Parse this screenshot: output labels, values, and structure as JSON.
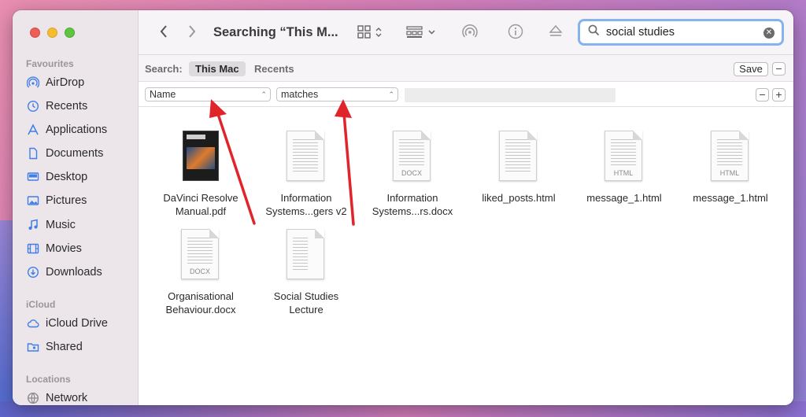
{
  "window": {
    "title": "Searching “This M...",
    "search_value": "social studies"
  },
  "sidebar": {
    "sections": [
      {
        "label": "Favourites"
      },
      {
        "label": "iCloud"
      },
      {
        "label": "Locations"
      }
    ],
    "favourites": [
      {
        "label": "AirDrop",
        "icon": "airdrop-icon"
      },
      {
        "label": "Recents",
        "icon": "clock-icon"
      },
      {
        "label": "Applications",
        "icon": "applications-icon"
      },
      {
        "label": "Documents",
        "icon": "document-icon"
      },
      {
        "label": "Desktop",
        "icon": "desktop-icon"
      },
      {
        "label": "Pictures",
        "icon": "photo-icon"
      },
      {
        "label": "Music",
        "icon": "music-icon"
      },
      {
        "label": "Movies",
        "icon": "film-icon"
      },
      {
        "label": "Downloads",
        "icon": "download-icon"
      }
    ],
    "icloud": [
      {
        "label": "iCloud Drive",
        "icon": "cloud-icon"
      },
      {
        "label": "Shared",
        "icon": "shared-folder-icon"
      }
    ],
    "locations": [
      {
        "label": "Network",
        "icon": "globe-icon"
      }
    ]
  },
  "scope": {
    "label": "Search:",
    "this_mac": "This Mac",
    "recents": "Recents",
    "save": "Save"
  },
  "rule": {
    "attribute": "Name",
    "operator": "matches"
  },
  "files": [
    {
      "name": "DaVinci Resolve Manual.pdf",
      "line1": "DaVinci Resolve",
      "line2": "Manual.pdf",
      "kind": "pdf"
    },
    {
      "name": "Information Systems...gers v2",
      "line1": "Information",
      "line2": "Systems...gers v2",
      "kind": "text"
    },
    {
      "name": "Information Systems...rs.docx",
      "line1": "Information",
      "line2": "Systems...rs.docx",
      "kind": "docx",
      "tag": "DOCX"
    },
    {
      "name": "liked_posts.html",
      "line1": "liked_posts.html",
      "line2": "",
      "kind": "text"
    },
    {
      "name": "message_1.html",
      "line1": "message_1.html",
      "line2": "",
      "kind": "html",
      "tag": "HTML"
    },
    {
      "name": "message_1.html",
      "line1": "message_1.html",
      "line2": "",
      "kind": "html",
      "tag": "HTML"
    },
    {
      "name": "Organisational Behaviour.docx",
      "line1": "Organisational",
      "line2": "Behaviour.docx",
      "kind": "docx",
      "tag": "DOCX"
    },
    {
      "name": "Social Studies Lecture",
      "line1": "Social Studies",
      "line2": "Lecture",
      "kind": "text"
    }
  ],
  "colors": {
    "annotation_arrow": "#e0242a",
    "search_focus": "#86b3ef",
    "sidebar_icon": "#3d7ee8"
  }
}
